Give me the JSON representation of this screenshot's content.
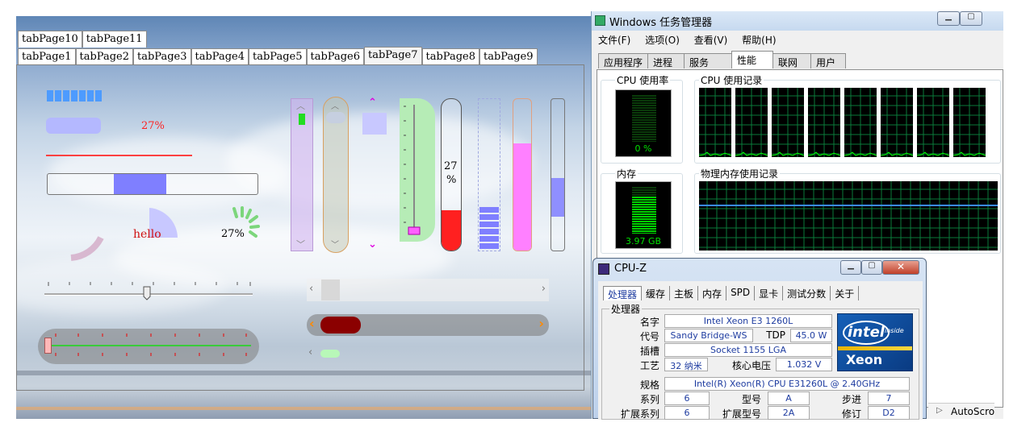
{
  "tabs": {
    "row1": [
      "tabPage10",
      "tabPage11"
    ],
    "row2": [
      "tabPage1",
      "tabPage2",
      "tabPage3",
      "tabPage4",
      "tabPage5",
      "tabPage6",
      "tabPage7",
      "tabPage8",
      "tabPage9"
    ],
    "active": "tabPage7"
  },
  "widgets": {
    "progress_percent_label": "27%",
    "ring_label": "hello",
    "spinner_label": "27%",
    "thermo_label_top": "27",
    "thermo_label_bottom": "%"
  },
  "taskmgr": {
    "title": "Windows 任务管理器",
    "menu": [
      "文件(F)",
      "选项(O)",
      "查看(V)",
      "帮助(H)"
    ],
    "tabs": [
      "应用程序",
      "进程",
      "服务",
      "性能",
      "联网",
      "用户"
    ],
    "active_tab": "性能",
    "cpu_usage_label": "CPU 使用率",
    "cpu_usage_value": "0 %",
    "cpu_history_label": "CPU 使用记录",
    "memory_label": "内存",
    "memory_value": "3.97 GB",
    "memory_history_label": "物理内存使用记录",
    "cpu_cores": 8
  },
  "cpuz": {
    "title": "CPU-Z",
    "tabs": [
      "处理器",
      "缓存",
      "主板",
      "内存",
      "SPD",
      "显卡",
      "测试分数",
      "关于"
    ],
    "active_tab": "处理器",
    "group_label": "处理器",
    "fields": {
      "name_label": "名字",
      "name": "Intel Xeon E3 1260L",
      "codename_label": "代号",
      "codename": "Sandy Bridge-WS",
      "tdp_label": "TDP",
      "tdp": "45.0 W",
      "socket_label": "插槽",
      "socket": "Socket 1155 LGA",
      "tech_label": "工艺",
      "tech": "32 纳米",
      "voltage_label": "核心电压",
      "voltage": "1.032 V",
      "spec_label": "规格",
      "spec": "Intel(R) Xeon(R) CPU E31260L @ 2.40GHz",
      "family_label": "系列",
      "family": "6",
      "model_label": "型号",
      "model": "A",
      "stepping_label": "步进",
      "stepping": "7",
      "extfamily_label": "扩展系列",
      "extfamily": "6",
      "extmodel_label": "扩展型号",
      "extmodel": "2A",
      "revision_label": "修订",
      "revision": "D2"
    },
    "logo_brand": "intel",
    "logo_inside": "inside",
    "logo_product": "Xeon"
  },
  "autoscroll": "AutoScro",
  "colors": {
    "progress_blue": "#7f7fff",
    "red": "#ff2020",
    "magenta": "#ff80ff",
    "green": "#7cd67c",
    "scope_green": "#00c800"
  }
}
